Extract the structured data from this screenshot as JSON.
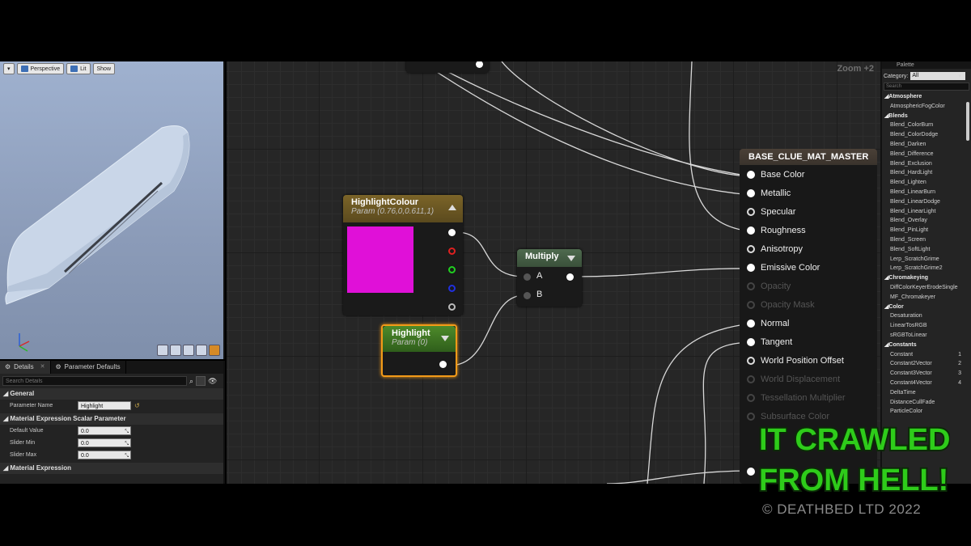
{
  "viewport": {
    "toolbar": {
      "perspective": "Perspective",
      "lit": "Lit",
      "show": "Show"
    }
  },
  "details": {
    "tabs": [
      {
        "label": "Details"
      },
      {
        "label": "Parameter Defaults"
      }
    ],
    "search_placeholder": "Search Details",
    "sections": {
      "general": "General",
      "scalar": "Material Expression Scalar Parameter",
      "expression": "Material Expression"
    },
    "parameter_name": {
      "label": "Parameter Name",
      "value": "Highlight"
    },
    "default_value": {
      "label": "Default Value",
      "value": "0.0"
    },
    "slider_min": {
      "label": "Slider Min",
      "value": "0.0"
    },
    "slider_max": {
      "label": "Slider Max",
      "value": "0.0"
    }
  },
  "graph": {
    "zoom": "Zoom +2",
    "highlight_colour": {
      "title": "HighlightColour",
      "subtitle": "Param (0.76,0,0.611,1)",
      "swatch_color": "#e010d8"
    },
    "multiply": {
      "title": "Multiply",
      "input_a": "A",
      "input_b": "B"
    },
    "highlight": {
      "title": "Highlight",
      "subtitle": "Param (0)"
    },
    "master": {
      "title": "BASE_CLUE_MAT_MASTER",
      "inputs": [
        {
          "label": "Base Color",
          "active": true,
          "connected": true
        },
        {
          "label": "Metallic",
          "active": true,
          "connected": true
        },
        {
          "label": "Specular",
          "active": true,
          "connected": false
        },
        {
          "label": "Roughness",
          "active": true,
          "connected": true
        },
        {
          "label": "Anisotropy",
          "active": true,
          "connected": false
        },
        {
          "label": "Emissive Color",
          "active": true,
          "connected": true
        },
        {
          "label": "Opacity",
          "active": false,
          "connected": false
        },
        {
          "label": "Opacity Mask",
          "active": false,
          "connected": false
        },
        {
          "label": "Normal",
          "active": true,
          "connected": true
        },
        {
          "label": "Tangent",
          "active": true,
          "connected": true
        },
        {
          "label": "World Position Offset",
          "active": true,
          "connected": false
        },
        {
          "label": "World Displacement",
          "active": false,
          "connected": false
        },
        {
          "label": "Tessellation Multiplier",
          "active": false,
          "connected": false
        },
        {
          "label": "Subsurface Color",
          "active": false,
          "connected": false
        }
      ]
    }
  },
  "palette": {
    "tab": "Palette",
    "category_label": "Category:",
    "category_value": "All",
    "search_placeholder": "Search",
    "items": [
      {
        "label": "Atmosphere",
        "cat": true
      },
      {
        "label": "AtmosphericFogColor"
      },
      {
        "label": "Blends",
        "cat": true
      },
      {
        "label": "Blend_ColorBurn"
      },
      {
        "label": "Blend_ColorDodge"
      },
      {
        "label": "Blend_Darken"
      },
      {
        "label": "Blend_Difference"
      },
      {
        "label": "Blend_Exclusion"
      },
      {
        "label": "Blend_HardLight"
      },
      {
        "label": "Blend_Lighten"
      },
      {
        "label": "Blend_LinearBurn"
      },
      {
        "label": "Blend_LinearDodge"
      },
      {
        "label": "Blend_LinearLight"
      },
      {
        "label": "Blend_Overlay"
      },
      {
        "label": "Blend_PinLight"
      },
      {
        "label": "Blend_Screen"
      },
      {
        "label": "Blend_SoftLight"
      },
      {
        "label": "Lerp_ScratchGrime"
      },
      {
        "label": "Lerp_ScratchGrime2"
      },
      {
        "label": "Chromakeying",
        "cat": true
      },
      {
        "label": "DiffColorKeyerErodeSingle"
      },
      {
        "label": "MF_Chromakeyer"
      },
      {
        "label": "Color",
        "cat": true
      },
      {
        "label": "Desaturation"
      },
      {
        "label": "LinearTosRGB"
      },
      {
        "label": "sRGBToLinear"
      },
      {
        "label": "Constants",
        "cat": true
      },
      {
        "label": "Constant",
        "num": "1"
      },
      {
        "label": "Constant2Vector",
        "num": "2"
      },
      {
        "label": "Constant3Vector",
        "num": "3"
      },
      {
        "label": "Constant4Vector",
        "num": "4"
      },
      {
        "label": "DeltaTime"
      },
      {
        "label": "DistanceCullFade"
      },
      {
        "label": "ParticleColor"
      }
    ]
  },
  "overlay": {
    "title_line1": "IT CRAWLED",
    "title_line2": "FROM HELL!",
    "title_color": "#2ecc1a",
    "copyright": "© DEATHBED LTD 2022"
  }
}
